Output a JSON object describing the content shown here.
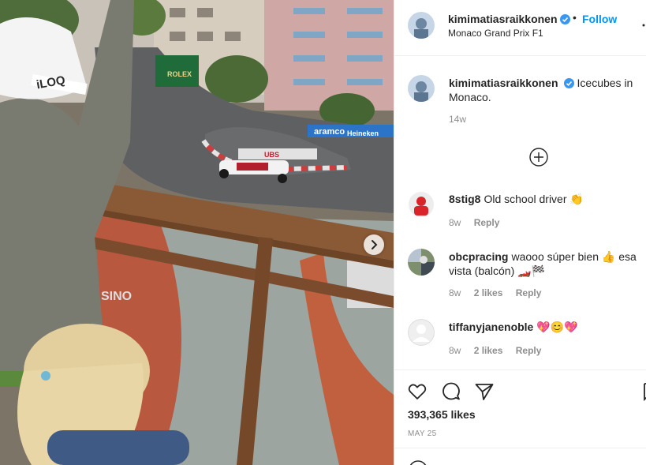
{
  "photo": {
    "banners": {
      "rolex": "ROLEX",
      "ubs": "UBS",
      "aramco": "aramco",
      "heineken": "Heineken",
      "iloq": "iLOQ",
      "casino": "SINO"
    },
    "next_icon": "chevron-right-icon"
  },
  "post": {
    "username": "kimimatiasraikkonen",
    "follow_label": "Follow",
    "separator": "•",
    "location": "Monaco Grand Prix F1",
    "caption": "Icecubes in Monaco.",
    "caption_time": "14w"
  },
  "comments": [
    {
      "username": "8stig8",
      "text": "Old school driver 👏",
      "time": "8w",
      "likes": "",
      "reply": "Reply"
    },
    {
      "username": "obcpracing",
      "text": "waooo súper bien 👍 esa vista (balcón) 🏎️🏁",
      "time": "8w",
      "likes": "2 likes",
      "reply": "Reply"
    },
    {
      "username": "tiffanyjanenoble",
      "text": "💖😊💖",
      "time": "8w",
      "likes": "2 likes",
      "reply": "Reply"
    }
  ],
  "actions": {
    "icons": [
      "heart-icon",
      "comment-icon",
      "share-icon",
      "bookmark-icon"
    ],
    "likes": "393,365 likes",
    "date": "MAY 25"
  },
  "colors": {
    "accent": "#0095f6",
    "verified": "#3897f0",
    "secondary_text": "#8e8e8e",
    "border": "#efefef"
  }
}
